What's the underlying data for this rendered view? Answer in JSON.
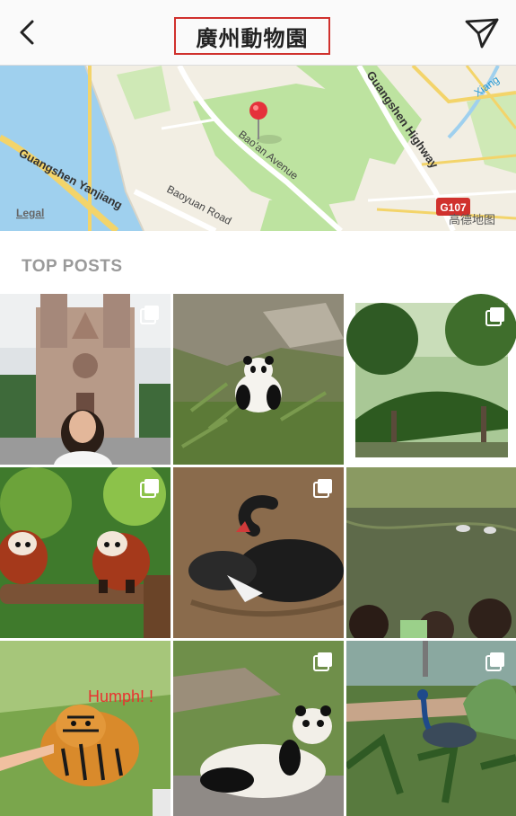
{
  "header": {
    "title": "廣州動物園",
    "back_icon": "chevron-left-icon",
    "share_icon": "paper-plane-icon"
  },
  "map": {
    "labels": {
      "guangshen_yanjiang": "Guangshen Yanjiang",
      "baoan_avenue": "Bao'an Avenue",
      "baoyuan_road": "Baoyuan Road",
      "guangshen_highway": "Guangshen Highway",
      "xiang": "Xiang",
      "legal": "Legal",
      "route_badge": "G107",
      "provider": "高德地图"
    },
    "pin_icon": "map-pin-icon"
  },
  "section": {
    "top_posts_label": "TOP POSTS"
  },
  "posts": [
    {
      "subject": "cathedral-selfie",
      "multi": true
    },
    {
      "subject": "panda-eating-bamboo",
      "multi": false
    },
    {
      "subject": "green-pergola-walkway",
      "multi": true
    },
    {
      "subject": "red-pandas-on-branch",
      "multi": true
    },
    {
      "subject": "black-swan",
      "multi": true
    },
    {
      "subject": "pond-with-ducks",
      "multi": false
    },
    {
      "subject": "tiger-feeding",
      "multi": false,
      "overlay_text": "Humph! !"
    },
    {
      "subject": "panda-lounging",
      "multi": true
    },
    {
      "subject": "peacock-in-garden",
      "multi": true
    }
  ],
  "colors": {
    "accent_red": "#d0312d",
    "water": "#9fd0ee",
    "park": "#bde3a0"
  }
}
